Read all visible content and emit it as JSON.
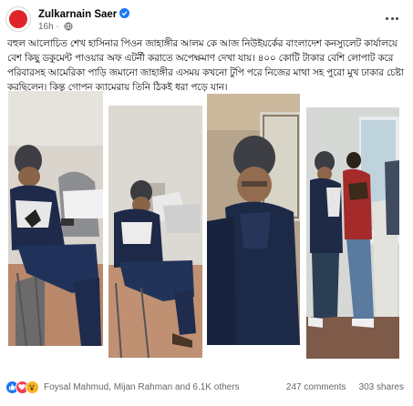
{
  "post": {
    "author": "Zulkarnain Saer",
    "time": "16h",
    "caption": "বহুল আলোচিত শেখ হাসিনার পিওন জাহাঙ্গীর আলম কে আজ নিউইয়র্কের বাংলাদেশ কনস্যুলেট কার্যালয়ে বেশ কিছু ডকুমেন্ট পাওয়ার অফ এটর্নী করাতে অপেক্ষমাণ দেখা যায়। ৪০০ কোটি টাকার বেশি লোপাট করে পরিবারসহ আমেরিকা পাড়ি জমানো জাহাঙ্গীর এসময় কখনো টুপি পরে নিজের মাথা সহ পুরো মুখ ঢাকার চেষ্টা করছিলেন। কিন্তু গোপন ক্যামেরায় তিনি ঠিকই ধরা পড়ে যান।"
  },
  "reactions": {
    "names": "Foysal Mahmud, Mijan Rahman and 6.1K others",
    "comments": "247 comments",
    "shares": "303 shares"
  },
  "icons": {
    "verified": "verified-badge-icon",
    "audience": "globe-icon",
    "menu": "more-options-icon",
    "like": "like-reaction-icon",
    "love": "love-reaction-icon",
    "wow": "wow-reaction-icon"
  },
  "colors": {
    "brand_blue": "#1877f2",
    "love_red": "#f33e58",
    "wow_yellow": "#f7b125",
    "secondary_text": "#65676b",
    "avatar_red": "#e0242a"
  }
}
